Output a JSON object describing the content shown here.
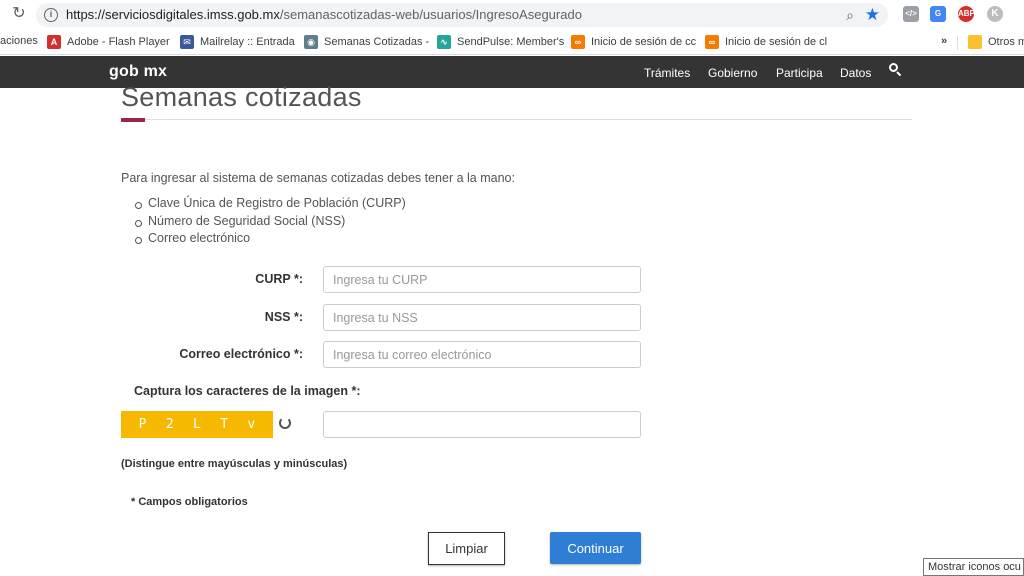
{
  "browser": {
    "url_domain": "https://serviciosdigitales.imss.gob.mx",
    "url_path": "/semanascotizadas-web/usuarios/IngresoAsegurado",
    "extensions": {
      "abp_label": "ABP",
      "profile_initial": "K"
    },
    "bookmarks": [
      {
        "label": "aciones"
      },
      {
        "label": "Adobe - Flash Player"
      },
      {
        "label": "Mailrelay :: Entrada"
      },
      {
        "label": "Semanas Cotizadas -"
      },
      {
        "label": "SendPulse: Member's"
      },
      {
        "label": "Inicio de sesión de cc"
      },
      {
        "label": "Inicio de sesión de cl"
      }
    ],
    "bookmarks_overflow": "»",
    "other_bookmarks": "Otros m"
  },
  "site_header": {
    "logo": "gob mx",
    "nav": [
      "Trámites",
      "Gobierno",
      "Participa",
      "Datos"
    ]
  },
  "page": {
    "title": "Semanas cotizadas",
    "intro": "Para ingresar al sistema de semanas cotizadas debes tener a la mano:",
    "requirements": [
      "Clave Única de Registro de Población (CURP)",
      "Número de Seguridad Social (NSS)",
      "Correo electrónico"
    ]
  },
  "form": {
    "curp": {
      "label": "CURP *:",
      "placeholder": "Ingresa tu CURP",
      "value": ""
    },
    "nss": {
      "label": "NSS *:",
      "placeholder": "Ingresa tu NSS",
      "value": ""
    },
    "email": {
      "label": "Correo electrónico *:",
      "placeholder": "Ingresa tu correo electrónico",
      "value": ""
    },
    "captcha": {
      "label": "Captura los caracteres de la imagen *:",
      "characters": [
        "P",
        "2",
        "L",
        "T",
        "v"
      ],
      "value": ""
    },
    "case_note": "(Distingue entre mayúsculas y minúsculas)",
    "required_note": "* Campos obligatorios",
    "clear_label": "Limpiar",
    "continue_label": "Continuar"
  },
  "tooltip": "Mostrar iconos ocu",
  "colors": {
    "header_bg": "#343434",
    "accent": "#9d2449",
    "captcha_bg": "#f6b900",
    "continue_bg": "#2e7ed6"
  }
}
